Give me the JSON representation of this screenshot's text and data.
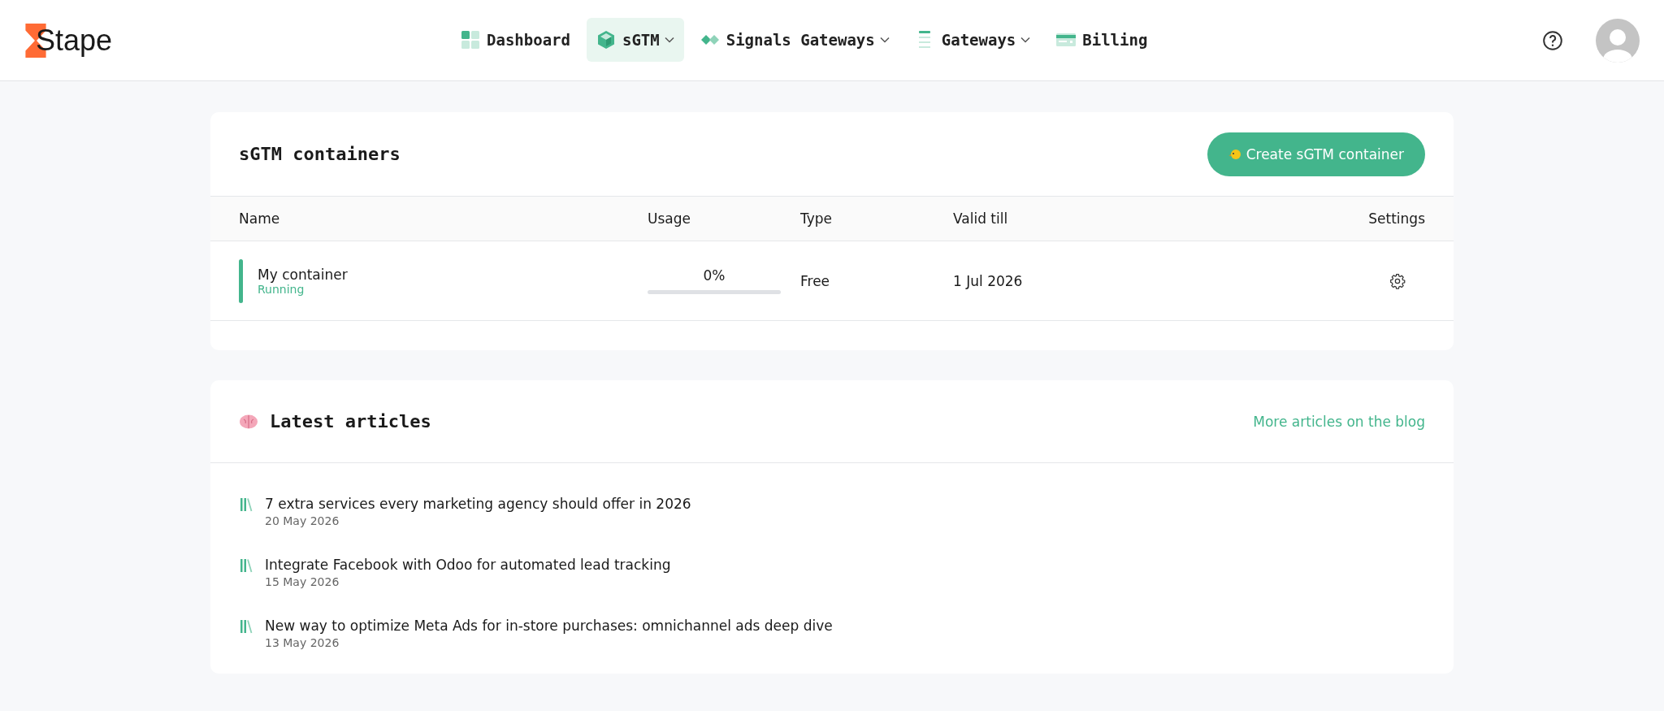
{
  "logo": {
    "text": "Stape"
  },
  "nav": [
    {
      "label": "Dashboard",
      "kind": "grid",
      "dropdown": false,
      "selected": false
    },
    {
      "label": "sGTM",
      "kind": "cube",
      "dropdown": true,
      "selected": true
    },
    {
      "label": "Signals Gateways",
      "kind": "diamond",
      "dropdown": true,
      "selected": false
    },
    {
      "label": "Gateways",
      "kind": "lines",
      "dropdown": true,
      "selected": false
    },
    {
      "label": "Billing",
      "kind": "card",
      "dropdown": false,
      "selected": false
    }
  ],
  "containers": {
    "title": "sGTM containers",
    "create_button": "Create sGTM container",
    "columns": [
      "Name",
      "Usage",
      "Type",
      "Valid till",
      "Settings"
    ],
    "rows": [
      {
        "name": "My container",
        "status": "Running",
        "running": true,
        "usage": "0%",
        "level": 0,
        "type": "Free",
        "valid_till": "1 Jul 2026"
      }
    ]
  },
  "articles": {
    "title": "Latest articles",
    "more_link": "More articles on the blog",
    "items": [
      {
        "title": "7 extra services every marketing agency should offer in 2026",
        "date": "20 May 2026"
      },
      {
        "title": "Integrate Facebook with Odoo for automated lead tracking",
        "date": "15 May 2026"
      },
      {
        "title": "New way to optimize Meta Ads for in-store purchases: omnichannel ads deep dive",
        "date": "13 May 2026"
      }
    ]
  }
}
